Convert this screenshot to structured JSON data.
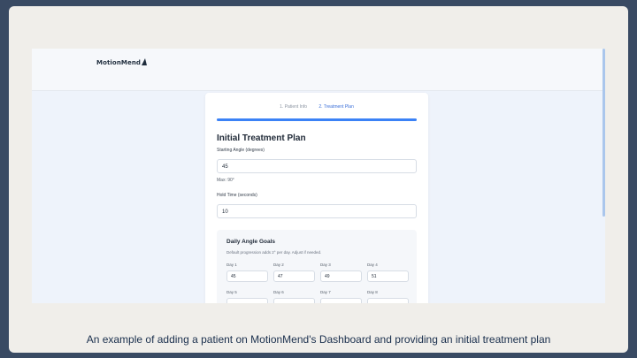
{
  "app": {
    "logo_text": "MotionMend"
  },
  "stepper": {
    "steps": [
      {
        "label": "1. Patient Info"
      },
      {
        "label": "2. Treatment Plan"
      }
    ],
    "progress_fraction": 1.0
  },
  "form": {
    "title": "Initial Treatment Plan",
    "starting_angle": {
      "label": "Starting Angle (degrees)",
      "value": "45",
      "hint": "Max: 90°"
    },
    "hold_time": {
      "label": "Hold Time (seconds)",
      "value": "10"
    }
  },
  "goals": {
    "title": "Daily Angle Goals",
    "description": "Default progression adds 2° per day. Adjust if needed.",
    "days": [
      {
        "label": "Day 1",
        "value": "45"
      },
      {
        "label": "Day 2",
        "value": "47"
      },
      {
        "label": "Day 3",
        "value": "49"
      },
      {
        "label": "Day 4",
        "value": "51"
      },
      {
        "label": "Day 5",
        "value": ""
      },
      {
        "label": "Day 6",
        "value": ""
      },
      {
        "label": "Day 7",
        "value": ""
      },
      {
        "label": "Day 8",
        "value": ""
      }
    ]
  },
  "caption": "An example of adding a patient on MotionMend's Dashboard and providing an initial treatment plan"
}
